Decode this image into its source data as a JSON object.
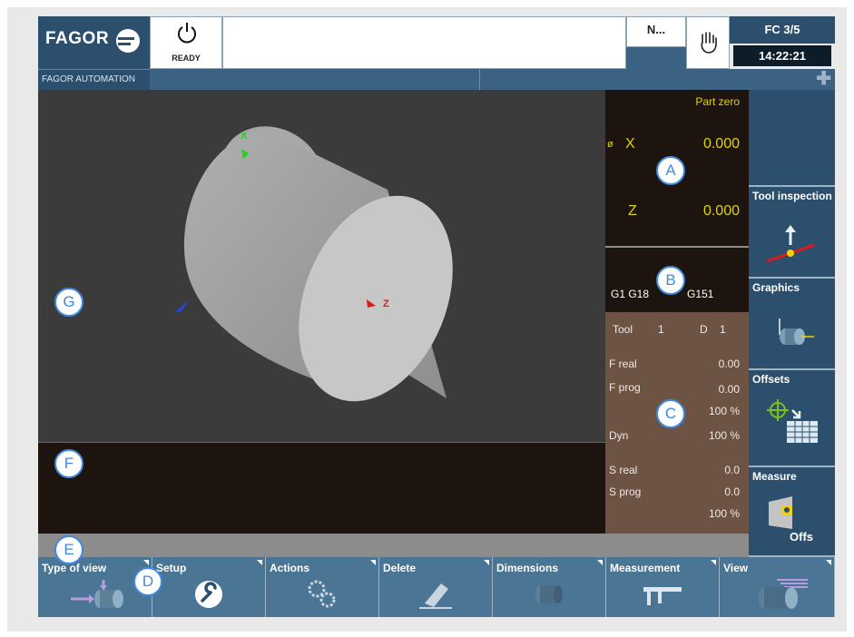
{
  "header": {
    "brand": "FAGOR",
    "brand_sub": "FAGOR AUTOMATION",
    "status": "READY",
    "status_icon": "power-icon",
    "mode_short": "N...",
    "hand_icon": "hand-icon",
    "fc_label": "FC 3/5",
    "time": "14:22:21",
    "plus_icon": "plus-icon"
  },
  "viewport": {
    "axis_x": "X",
    "axis_z": "Z"
  },
  "position": {
    "title": "Part zero",
    "diameter_symbol": "ø",
    "x_label": "X",
    "x_value": "0.000",
    "z_label": "Z",
    "z_value": "0.000"
  },
  "gcodes": {
    "text": "G1 G18",
    "text2": "G151"
  },
  "machining": {
    "tool_label": "Tool",
    "tool_value": "1",
    "d_label": "D",
    "d_value": "1",
    "f_real_label": "F real",
    "f_real_value": "0.00",
    "f_prog_label": "F prog",
    "f_prog_value": "0.00",
    "f_override": "100 %",
    "dyn_label": "Dyn",
    "dyn_value": "100 %",
    "s_real_label": "S real",
    "s_real_value": "0.0",
    "s_prog_label": "S prog",
    "s_prog_value": "0.0",
    "s_override": "100 %"
  },
  "side_softkeys": [
    {
      "label": ""
    },
    {
      "label": "Tool inspection"
    },
    {
      "label": "Graphics"
    },
    {
      "label": "Offsets"
    },
    {
      "label": "Measure",
      "sub": "Offs"
    }
  ],
  "bottom_softkeys": [
    {
      "label": "Type of view"
    },
    {
      "label": "Setup"
    },
    {
      "label": "Actions"
    },
    {
      "label": "Delete"
    },
    {
      "label": "Dimensions"
    },
    {
      "label": "Measurement"
    },
    {
      "label": "View"
    }
  ],
  "callouts": {
    "a": "A",
    "b": "B",
    "c": "C",
    "d": "D",
    "e": "E",
    "f": "F",
    "g": "G"
  },
  "colors": {
    "panel_blue": "#2c4f6e",
    "softkey_blue": "#4b7595",
    "dark_panel": "#1d140f",
    "machining_panel": "#6c5343",
    "position_yellow": "#ddd400",
    "callout_blue": "#3f8ae0"
  }
}
